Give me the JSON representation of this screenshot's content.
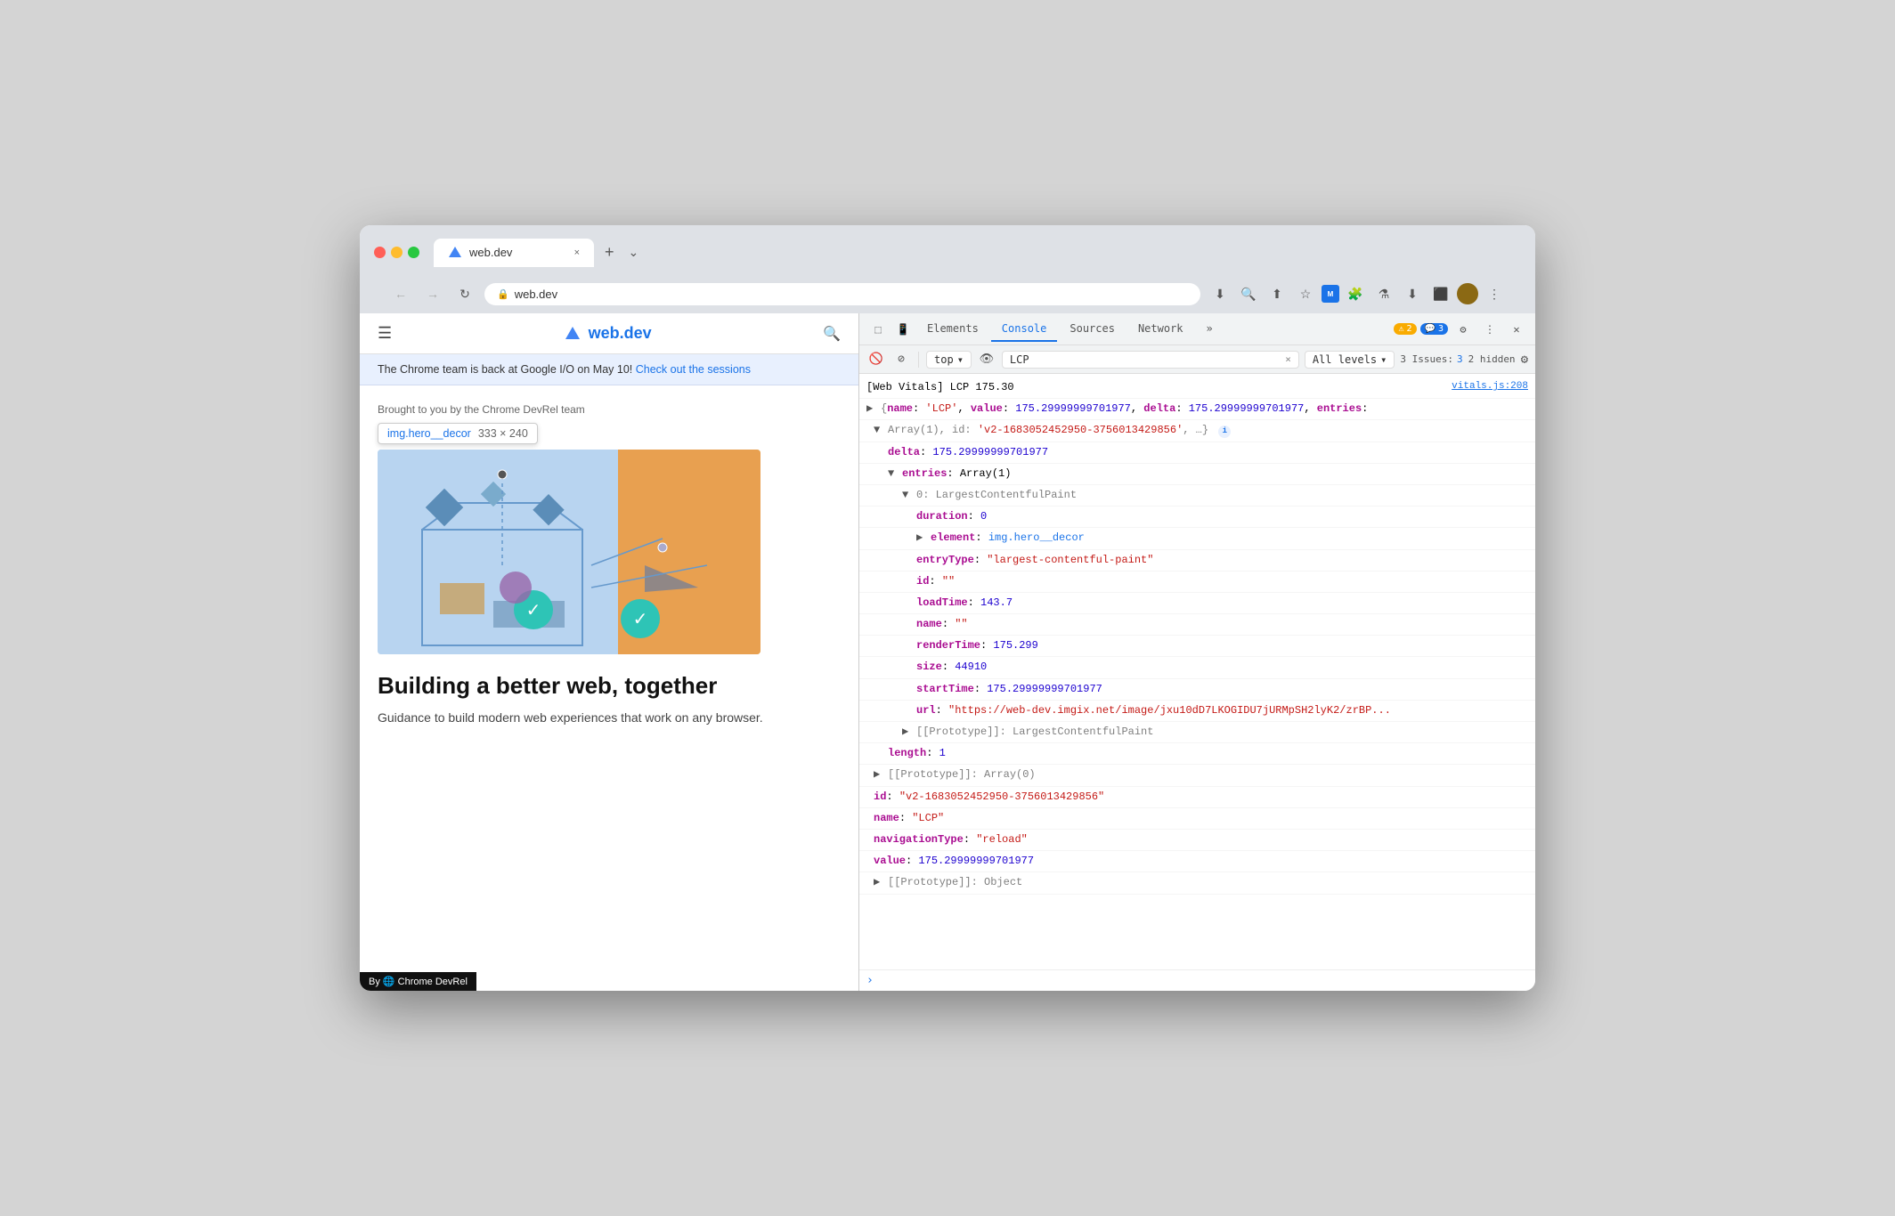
{
  "browser": {
    "tab_title": "web.dev",
    "tab_close": "×",
    "tab_new": "+",
    "tab_chevron": "⌄",
    "address_url": "web.dev",
    "address_protocol": "🔒",
    "nav_back": "←",
    "nav_forward": "→",
    "nav_reload": "↻"
  },
  "browser_actions": {
    "download_page": "⬇",
    "zoom": "🔍",
    "share": "⬆",
    "bookmark": "☆",
    "extension_green": "🟦",
    "puzzle": "🧩",
    "flask": "⚗",
    "download": "⬇",
    "split": "⬛",
    "more": "⋮"
  },
  "webpage": {
    "hamburger": "☰",
    "logo_text": "web.dev",
    "search_icon": "🔍",
    "announce": "The Chrome team is back at Google I/O on May 10!",
    "announce_link": "Check out the sessions",
    "devrel": "Brought to you by the Chrome DevRel team",
    "element_tooltip": {
      "name": "img.hero__decor",
      "size": "333 × 240"
    },
    "page_title": "Building a better web, together",
    "page_desc": "Guidance to build modern web experiences that work on any browser.",
    "footer_badge": "By 🌐 Chrome DevRel"
  },
  "devtools": {
    "tabs": [
      "Elements",
      "Console",
      "Sources",
      "Network"
    ],
    "active_tab": "Console",
    "more_tabs": "»",
    "warn_count": "2",
    "error_count": "3",
    "settings_label": "⚙",
    "more_options": "⋮",
    "close": "×",
    "cursor_icon": "⬚",
    "mobile_icon": "⬛"
  },
  "console_toolbar": {
    "clear": "🚫",
    "block": "⊘",
    "context_label": "top",
    "context_arrow": "▾",
    "eye_icon": "👁",
    "filter_text": "LCP",
    "filter_clear": "×",
    "level_label": "All levels",
    "level_arrow": "▾",
    "issues_label": "3 Issues:",
    "issues_count": "3",
    "hidden_label": "2 hidden",
    "settings_icon": "⚙"
  },
  "console": {
    "log_header": "[Web Vitals] LCP 175.30",
    "log_source": "vitals.js:208",
    "lines": [
      {
        "indent": 0,
        "prefix": "▶",
        "text": "{name: 'LCP', value: 175.29999999701977, delta: 175.29999999701977, entries:",
        "color": "normal"
      },
      {
        "indent": 1,
        "prefix": "▼",
        "text": "Array(1), id: 'v2-1683052452950-3756013429856', …}",
        "color": "normal"
      },
      {
        "indent": 2,
        "prefix": "",
        "text": "delta: 175.29999999701977",
        "color": "blue"
      },
      {
        "indent": 2,
        "prefix": "▼",
        "text": "entries: Array(1)",
        "color": "normal"
      },
      {
        "indent": 3,
        "prefix": "▼",
        "text": "0: LargestContentfulPaint",
        "color": "normal"
      },
      {
        "indent": 4,
        "prefix": "",
        "text": "duration: 0",
        "color": "normal"
      },
      {
        "indent": 4,
        "prefix": "▶",
        "text": "element: img.hero__decor",
        "color": "normal"
      },
      {
        "indent": 4,
        "prefix": "",
        "text": "entryType: \"largest-contentful-paint\"",
        "color": "normal"
      },
      {
        "indent": 4,
        "prefix": "",
        "text": "id: \"\"",
        "color": "normal"
      },
      {
        "indent": 4,
        "prefix": "",
        "text": "loadTime: 143.7",
        "color": "normal"
      },
      {
        "indent": 4,
        "prefix": "",
        "text": "name: \"\"",
        "color": "normal"
      },
      {
        "indent": 4,
        "prefix": "",
        "text": "renderTime: 175.299",
        "color": "normal"
      },
      {
        "indent": 4,
        "prefix": "",
        "text": "size: 44910",
        "color": "normal"
      },
      {
        "indent": 4,
        "prefix": "",
        "text": "startTime: 175.29999999701977",
        "color": "normal"
      },
      {
        "indent": 4,
        "prefix": "",
        "text": "url: \"https://web-dev.imgix.net/image/jxu10dD7LKOGIDU7jURMpSH2lyK2/zrBP...",
        "color": "normal"
      },
      {
        "indent": 3,
        "prefix": "▶",
        "text": "[[Prototype]]: LargestContentfulPaint",
        "color": "normal"
      },
      {
        "indent": 2,
        "prefix": "",
        "text": "length: 1",
        "color": "purple"
      },
      {
        "indent": 1,
        "prefix": "▶",
        "text": "[[Prototype]]: Array(0)",
        "color": "normal"
      },
      {
        "indent": 1,
        "prefix": "",
        "text": "id: \"v2-1683052452950-3756013429856\"",
        "color": "red"
      },
      {
        "indent": 1,
        "prefix": "",
        "text": "name: \"LCP\"",
        "color": "red"
      },
      {
        "indent": 1,
        "prefix": "",
        "text": "navigationType: \"reload\"",
        "color": "red"
      },
      {
        "indent": 1,
        "prefix": "",
        "text": "value: 175.29999999701977",
        "color": "blue"
      },
      {
        "indent": 1,
        "prefix": "▶",
        "text": "[[Prototype]]: Object",
        "color": "normal"
      }
    ]
  }
}
